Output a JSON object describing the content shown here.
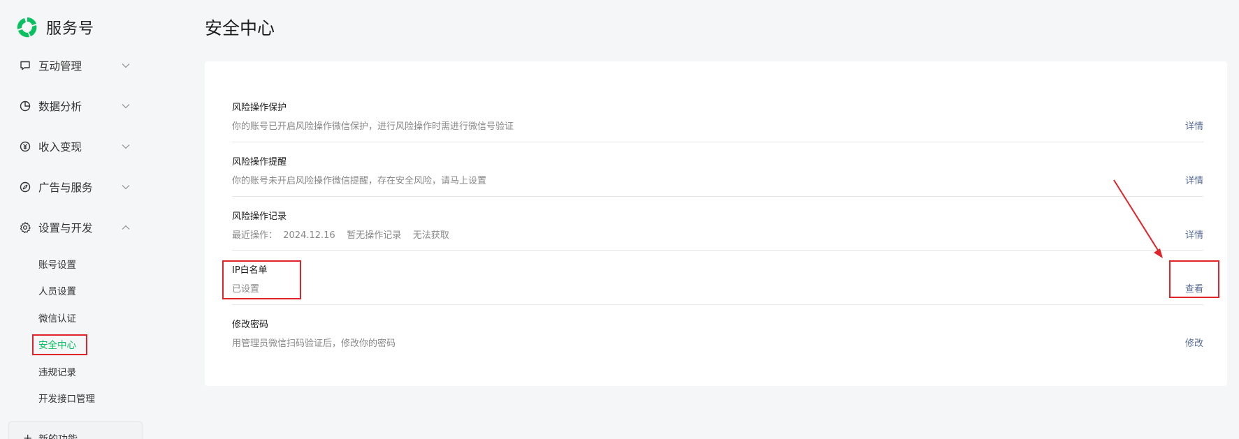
{
  "brand": {
    "name": "服务号",
    "logo_icon": "service-account-logo-icon",
    "logo_color": "#07c160"
  },
  "sidebar": {
    "items": [
      {
        "label": "互动管理",
        "icon": "chat-bubble-icon",
        "expanded": false
      },
      {
        "label": "数据分析",
        "icon": "pie-chart-icon",
        "expanded": false
      },
      {
        "label": "收入变现",
        "icon": "yen-circle-icon",
        "expanded": false
      },
      {
        "label": "广告与服务",
        "icon": "compass-icon",
        "expanded": false
      },
      {
        "label": "设置与开发",
        "icon": "gear-icon",
        "expanded": true
      }
    ],
    "sub_items": [
      {
        "label": "账号设置",
        "active": false
      },
      {
        "label": "人员设置",
        "active": false
      },
      {
        "label": "微信认证",
        "active": false
      },
      {
        "label": "安全中心",
        "active": true
      },
      {
        "label": "违规记录",
        "active": false
      },
      {
        "label": "开发接口管理",
        "active": false
      }
    ],
    "new_feature": {
      "plus": "+",
      "label": "新的功能"
    }
  },
  "main": {
    "title": "安全中心",
    "rows": [
      {
        "title": "风险操作保护",
        "desc": "你的账号已开启风险操作微信保护，进行风险操作时需进行微信号验证",
        "action": "详情"
      },
      {
        "title": "风险操作提醒",
        "desc": "你的账号未开启风险操作微信提醒，存在安全风险，请马上设置",
        "action": "详情"
      },
      {
        "title": "风险操作记录",
        "desc": "最近操作：  2024.12.16    暂无操作记录    无法获取",
        "action": "详情"
      },
      {
        "title": "IP白名单",
        "desc": "已设置",
        "action": "查看"
      },
      {
        "title": "修改密码",
        "desc": "用管理员微信扫码验证后，修改你的密码",
        "action": "修改"
      }
    ]
  },
  "colors": {
    "accent": "#07c160",
    "link": "#576b95",
    "annotation": "#e0242a"
  }
}
